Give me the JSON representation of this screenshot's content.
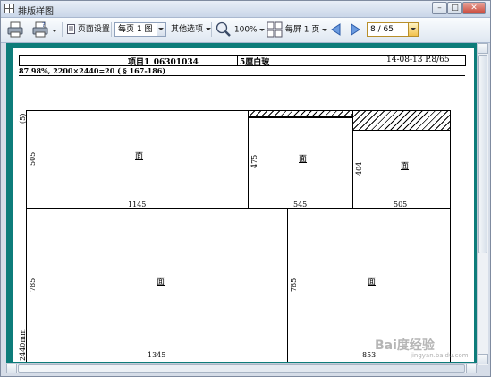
{
  "window": {
    "title": "排版样图",
    "min_glyph": "–",
    "max_glyph": "□",
    "close_glyph": "✕"
  },
  "toolbar": {
    "page_setup_label": "页面设置",
    "per_page_value": "每页 1 图",
    "other_options_label": "其他选项",
    "zoom_label": "100%",
    "per_screen_label": "每屏 1 页",
    "page_indicator": "8 / 65",
    "accent": "#f2c14c"
  },
  "paper": {
    "project": "项目1_06301034",
    "material": "5厘白玻",
    "date_page": "14-08-13 P.8/65",
    "stats_line": "87.98%, 2200×2440=20 ( § 167-186)",
    "sheet_count": "(5)",
    "sheet_height": "2440mm",
    "piece_label": "面",
    "pieces": [
      {
        "id": "p1",
        "width": "1145",
        "height": "505"
      },
      {
        "id": "p2",
        "width": "545",
        "height": "475"
      },
      {
        "id": "p3",
        "width": "505",
        "height": "404"
      },
      {
        "id": "p4",
        "width": "1345",
        "height": "785"
      },
      {
        "id": "p5",
        "width": "853",
        "height": "785"
      }
    ]
  },
  "colors": {
    "frame": "#0d7c7a",
    "chrome": "#d6dde8"
  },
  "watermark": {
    "logo_text": "Bai度经验",
    "sub_text": "jingyan.baidu.com"
  }
}
